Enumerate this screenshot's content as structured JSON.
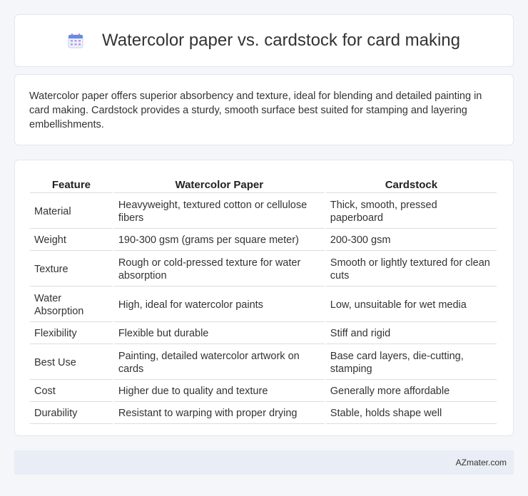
{
  "header": {
    "title": "Watercolor paper vs. cardstock for card making",
    "icon": "calendar-icon"
  },
  "summary": {
    "text": "Watercolor paper offers superior absorbency and texture, ideal for blending and detailed painting in card making. Cardstock provides a sturdy, smooth surface best suited for stamping and layering embellishments."
  },
  "table": {
    "headers": [
      "Feature",
      "Watercolor Paper",
      "Cardstock"
    ],
    "rows": [
      {
        "feature": "Material",
        "watercolor": "Heavyweight, textured cotton or cellulose fibers",
        "cardstock": "Thick, smooth, pressed paperboard"
      },
      {
        "feature": "Weight",
        "watercolor": "190-300 gsm (grams per square meter)",
        "cardstock": "200-300 gsm"
      },
      {
        "feature": "Texture",
        "watercolor": "Rough or cold-pressed texture for water absorption",
        "cardstock": "Smooth or lightly textured for clean cuts"
      },
      {
        "feature": "Water Absorption",
        "watercolor": "High, ideal for watercolor paints",
        "cardstock": "Low, unsuitable for wet media"
      },
      {
        "feature": "Flexibility",
        "watercolor": "Flexible but durable",
        "cardstock": "Stiff and rigid"
      },
      {
        "feature": "Best Use",
        "watercolor": "Painting, detailed watercolor artwork on cards",
        "cardstock": "Base card layers, die-cutting, stamping"
      },
      {
        "feature": "Cost",
        "watercolor": "Higher due to quality and texture",
        "cardstock": "Generally more affordable"
      },
      {
        "feature": "Durability",
        "watercolor": "Resistant to warping with proper drying",
        "cardstock": "Stable, holds shape well"
      }
    ]
  },
  "footer": {
    "brand": "AZmater.com"
  },
  "colors": {
    "background": "#f4f6fa",
    "footer_bg": "#e8edf6",
    "icon_accent": "#5b8def"
  }
}
